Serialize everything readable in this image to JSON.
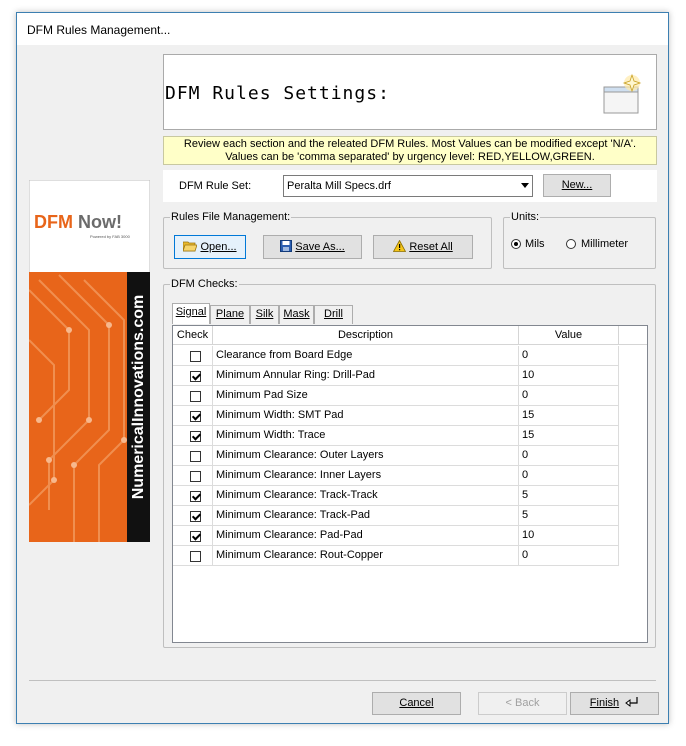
{
  "window": {
    "title": "DFM Rules Management..."
  },
  "banner": {
    "title": "DFM Rules Settings:",
    "icon": "wizard-sparkle-icon"
  },
  "notice": {
    "line1": "Review each section and the releated DFM Rules. Most Values can be modified except 'N/A'.",
    "line2": "Values can be 'comma separated' by urgency level: RED,YELLOW,GREEN."
  },
  "sidebar": {
    "logo_title": "DFM Now!",
    "logo_subtitle": "Powered by FAB 3000",
    "vertical_text": "NumericalInnovations.com"
  },
  "ruleset": {
    "label": "DFM Rule Set:",
    "selected": "Peralta Mill Specs.drf",
    "new_button": "New..."
  },
  "file_mgmt": {
    "title": "Rules File Management:",
    "open": "Open...",
    "save_as": "Save As...",
    "reset_all": "Reset All"
  },
  "units": {
    "title": "Units:",
    "options": [
      "Mils",
      "Millimeter"
    ],
    "selected": "Mils"
  },
  "checks": {
    "title": "DFM Checks:",
    "tabs": [
      "Signal",
      "Plane",
      "Silk",
      "Mask",
      "Drill"
    ],
    "active_tab": "Signal",
    "columns": [
      "Check",
      "Description",
      "Value"
    ],
    "rows": [
      {
        "checked": false,
        "description": "Clearance from Board Edge",
        "value": "0"
      },
      {
        "checked": true,
        "description": "Minimum Annular Ring: Drill-Pad",
        "value": "10"
      },
      {
        "checked": false,
        "description": "Minimum Pad Size",
        "value": "0"
      },
      {
        "checked": true,
        "description": "Minimum Width: SMT Pad",
        "value": "15"
      },
      {
        "checked": true,
        "description": "Minimum Width: Trace",
        "value": "15"
      },
      {
        "checked": false,
        "description": "Minimum Clearance: Outer Layers",
        "value": "0"
      },
      {
        "checked": false,
        "description": "Minimum Clearance: Inner Layers",
        "value": "0"
      },
      {
        "checked": true,
        "description": "Minimum Clearance: Track-Track",
        "value": "5"
      },
      {
        "checked": true,
        "description": "Minimum Clearance: Track-Pad",
        "value": "5"
      },
      {
        "checked": true,
        "description": "Minimum Clearance: Pad-Pad",
        "value": "10"
      },
      {
        "checked": false,
        "description": "Minimum Clearance: Rout-Copper",
        "value": "0"
      }
    ]
  },
  "footer": {
    "cancel": "Cancel",
    "back": "< Back",
    "finish": "Finish"
  },
  "colors": {
    "notice_bg": "#ffffc8",
    "logo_orange": "#e8651a",
    "window_border": "#3c7fb1"
  }
}
